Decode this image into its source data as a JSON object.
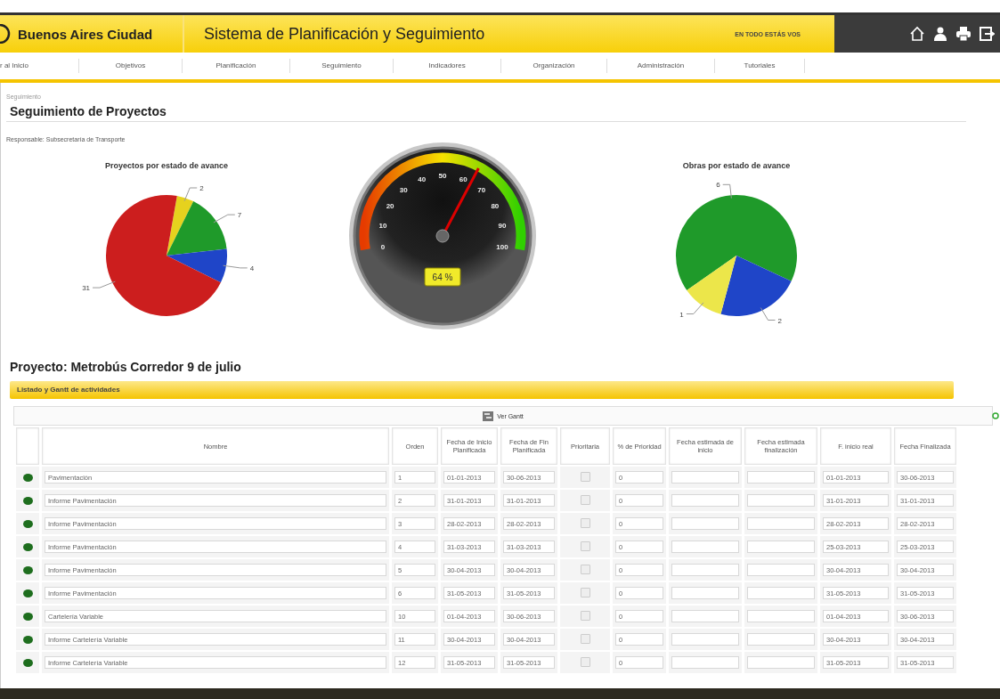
{
  "header": {
    "brand": "Buenos Aires Ciudad",
    "system_title": "Sistema de Planificación y Seguimiento",
    "slogan": "EN TODO ESTÁS VOS"
  },
  "nav": [
    {
      "label": "r al Inicio",
      "selected": false
    },
    {
      "label": "Objetivos",
      "selected": false
    },
    {
      "label": "Planificación",
      "selected": false
    },
    {
      "label": "Seguimiento",
      "selected": false
    },
    {
      "label": "Indicadores",
      "selected": false
    },
    {
      "label": "Organización",
      "selected": false
    },
    {
      "label": "Administración",
      "selected": false
    },
    {
      "label": "Tutoriales",
      "selected": false
    }
  ],
  "breadcrumb": "Seguimiento",
  "page_title": "Seguimiento de Proyectos",
  "responsible": "Responsable: Subsecretaría de Transporte",
  "charts": [
    {
      "kind": "pie",
      "chart_data": {
        "type": "pie",
        "title": "Proyectos por estado de avance",
        "values": [
          2,
          7,
          4,
          31
        ],
        "colors": [
          "#e6d21e",
          "#1f9a2a",
          "#1f45c8",
          "#cc1e1e"
        ],
        "value_labels": [
          "2",
          "7",
          "4",
          "31"
        ]
      }
    },
    {
      "kind": "gauge",
      "reading": "64 %",
      "scale": [
        "0",
        "10",
        "20",
        "30",
        "40",
        "50",
        "60",
        "70",
        "80",
        "90",
        "100"
      ]
    },
    {
      "kind": "pie",
      "chart_data": {
        "type": "pie",
        "title": "Obras por estado de avance",
        "values": [
          6,
          2,
          1
        ],
        "colors": [
          "#1f9a2a",
          "#1f45c8",
          "#ece64a"
        ],
        "value_labels": [
          "6",
          "2",
          "1"
        ]
      }
    }
  ],
  "project_title": "Proyecto: Metrobús Corredor 9 de julio",
  "panel": {
    "title": "Listado y Gantt de actividades",
    "gantt_button": "Ver Gantt"
  },
  "table": {
    "columns": [
      "Nombre",
      "Orden",
      "Fecha de Inicio Planificada",
      "Fecha de Fin Planificada",
      "Prioritaria",
      "% de Prioridad",
      "Fecha estimada de inicio",
      "Fecha estimada finalización",
      "F. inicio real",
      "Fecha Finalizada"
    ],
    "rows": [
      {
        "name": "Pavimentación",
        "order": "1",
        "plan_start": "01-01-2013",
        "plan_end": "30-06-2013",
        "checked": false,
        "priority": "0",
        "real_start": "01-01-2013",
        "finished": "30-06-2013"
      },
      {
        "name": "Informe Pavimentación",
        "order": "2",
        "plan_start": "31-01-2013",
        "plan_end": "31-01-2013",
        "checked": false,
        "priority": "0",
        "real_start": "31-01-2013",
        "finished": "31-01-2013"
      },
      {
        "name": "Informe Pavimentación",
        "order": "3",
        "plan_start": "28-02-2013",
        "plan_end": "28-02-2013",
        "checked": false,
        "priority": "0",
        "real_start": "28-02-2013",
        "finished": "28-02-2013"
      },
      {
        "name": "Informe Pavimentación",
        "order": "4",
        "plan_start": "31-03-2013",
        "plan_end": "31-03-2013",
        "checked": false,
        "priority": "0",
        "real_start": "25-03-2013",
        "finished": "25-03-2013"
      },
      {
        "name": "Informe Pavimentación",
        "order": "5",
        "plan_start": "30-04-2013",
        "plan_end": "30-04-2013",
        "checked": false,
        "priority": "0",
        "real_start": "30-04-2013",
        "finished": "30-04-2013"
      },
      {
        "name": "Informe Pavimentación",
        "order": "6",
        "plan_start": "31-05-2013",
        "plan_end": "31-05-2013",
        "checked": false,
        "priority": "0",
        "real_start": "31-05-2013",
        "finished": "31-05-2013"
      },
      {
        "name": "Cartelería Variable",
        "order": "10",
        "plan_start": "01-04-2013",
        "plan_end": "30-06-2013",
        "checked": false,
        "priority": "0",
        "real_start": "01-04-2013",
        "finished": "30-06-2013"
      },
      {
        "name": "Informe Cartelería Variable",
        "order": "11",
        "plan_start": "30-04-2013",
        "plan_end": "30-04-2013",
        "checked": false,
        "priority": "0",
        "real_start": "30-04-2013",
        "finished": "30-04-2013"
      },
      {
        "name": "Informe Cartelería Variable",
        "order": "12",
        "plan_start": "31-05-2013",
        "plan_end": "31-05-2013",
        "checked": false,
        "priority": "0",
        "real_start": "31-05-2013",
        "finished": "31-05-2013"
      }
    ]
  }
}
